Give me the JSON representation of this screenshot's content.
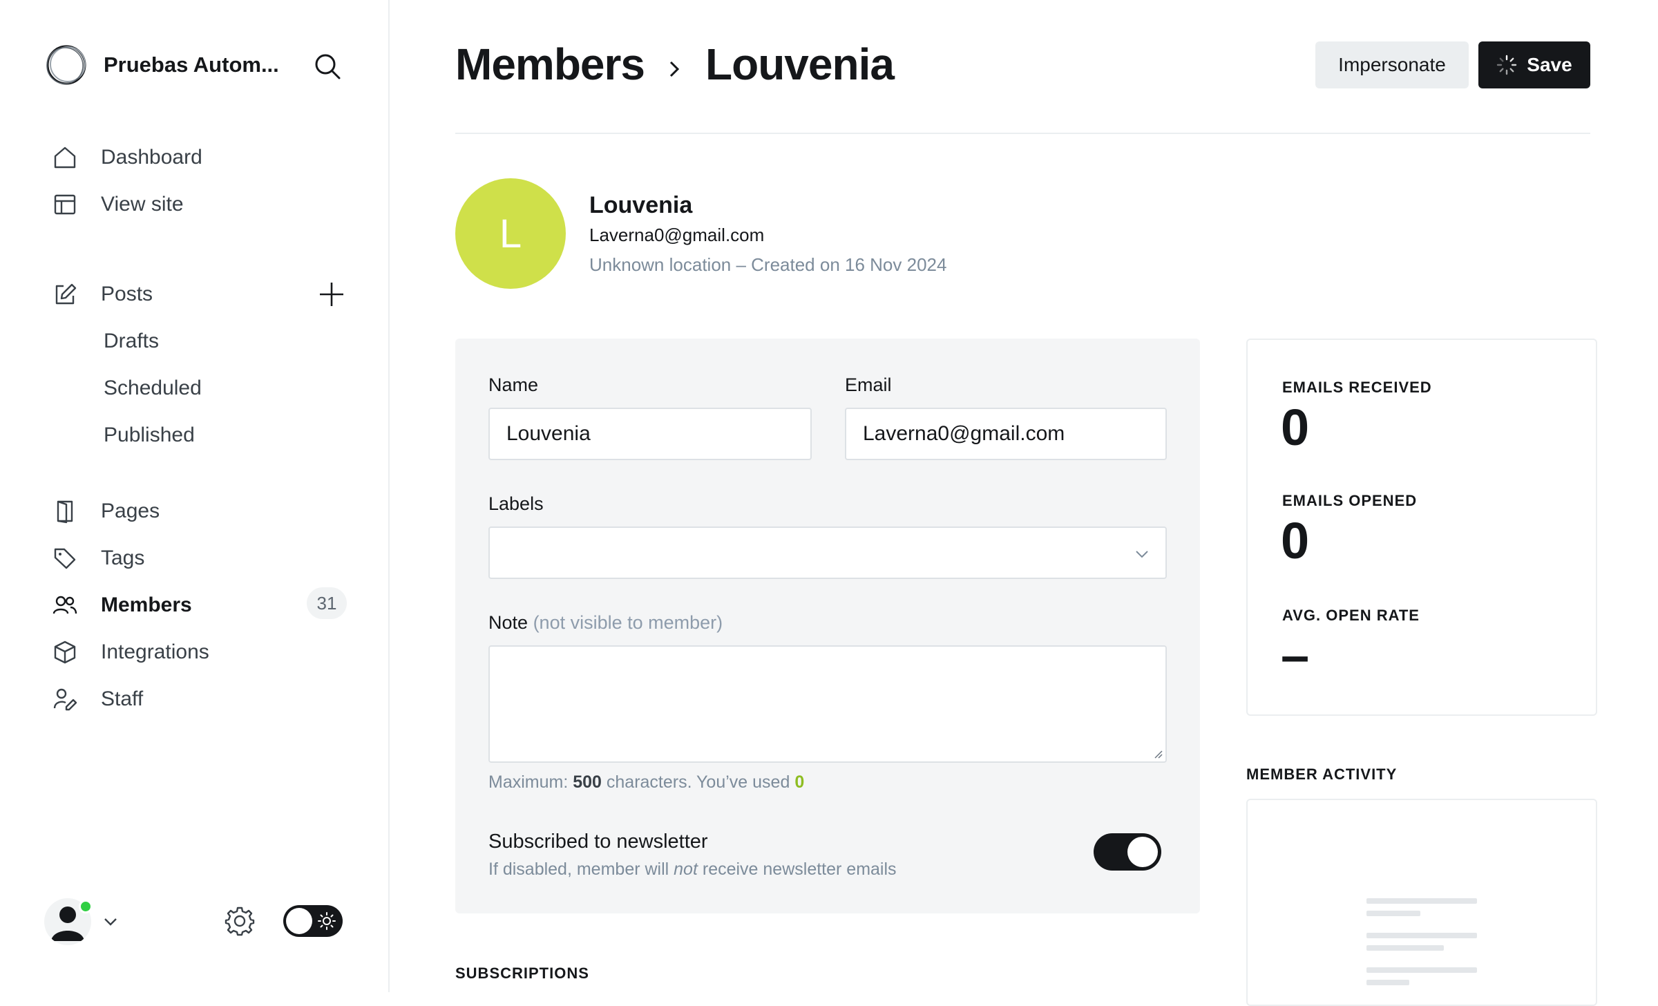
{
  "sidebar": {
    "site_name": "Pruebas Autom...",
    "nav_top": [
      {
        "label": "Dashboard",
        "icon": "home-icon"
      },
      {
        "label": "View site",
        "icon": "layout-icon"
      }
    ],
    "posts": {
      "label": "Posts",
      "icon": "edit-icon",
      "sub_items": [
        "Drafts",
        "Scheduled",
        "Published"
      ]
    },
    "nav_bottom": [
      {
        "label": "Pages",
        "icon": "page-icon"
      },
      {
        "label": "Tags",
        "icon": "tag-icon"
      },
      {
        "label": "Members",
        "icon": "members-icon",
        "active": true,
        "count": "31"
      },
      {
        "label": "Integrations",
        "icon": "cube-icon"
      },
      {
        "label": "Staff",
        "icon": "staff-icon"
      }
    ]
  },
  "header": {
    "breadcrumb_parent": "Members",
    "breadcrumb_current": "Louvenia",
    "impersonate_label": "Impersonate",
    "save_label": "Save"
  },
  "member": {
    "initial": "L",
    "name": "Louvenia",
    "email": "Laverna0@gmail.com",
    "subtitle": "Unknown location – Created on 16 Nov 2024",
    "avatar_color": "#cfe04a"
  },
  "form": {
    "name_label": "Name",
    "name_value": "Louvenia",
    "email_label": "Email",
    "email_value": "Laverna0@gmail.com",
    "labels_label": "Labels",
    "labels_value": "",
    "note_label": "Note",
    "note_hint": "(not visible to member)",
    "note_value": "",
    "char_prefix": "Maximum: ",
    "char_max": "500",
    "char_middle": " characters. You’ve used ",
    "char_used": "0",
    "newsletter_title": "Subscribed to newsletter",
    "newsletter_desc_before": "If disabled, member will ",
    "newsletter_desc_em": "not",
    "newsletter_desc_after": " receive newsletter emails",
    "newsletter_enabled": true
  },
  "sections": {
    "subscriptions": "SUBSCRIPTIONS",
    "member_activity": "MEMBER ACTIVITY"
  },
  "stats": [
    {
      "label": "EMAILS RECEIVED",
      "value": "0"
    },
    {
      "label": "EMAILS OPENED",
      "value": "0"
    },
    {
      "label": "AVG. OPEN RATE",
      "value": "–"
    }
  ],
  "colors": {
    "accent": "#15171a",
    "online": "#30cf43",
    "used_count": "#8ebd22"
  }
}
